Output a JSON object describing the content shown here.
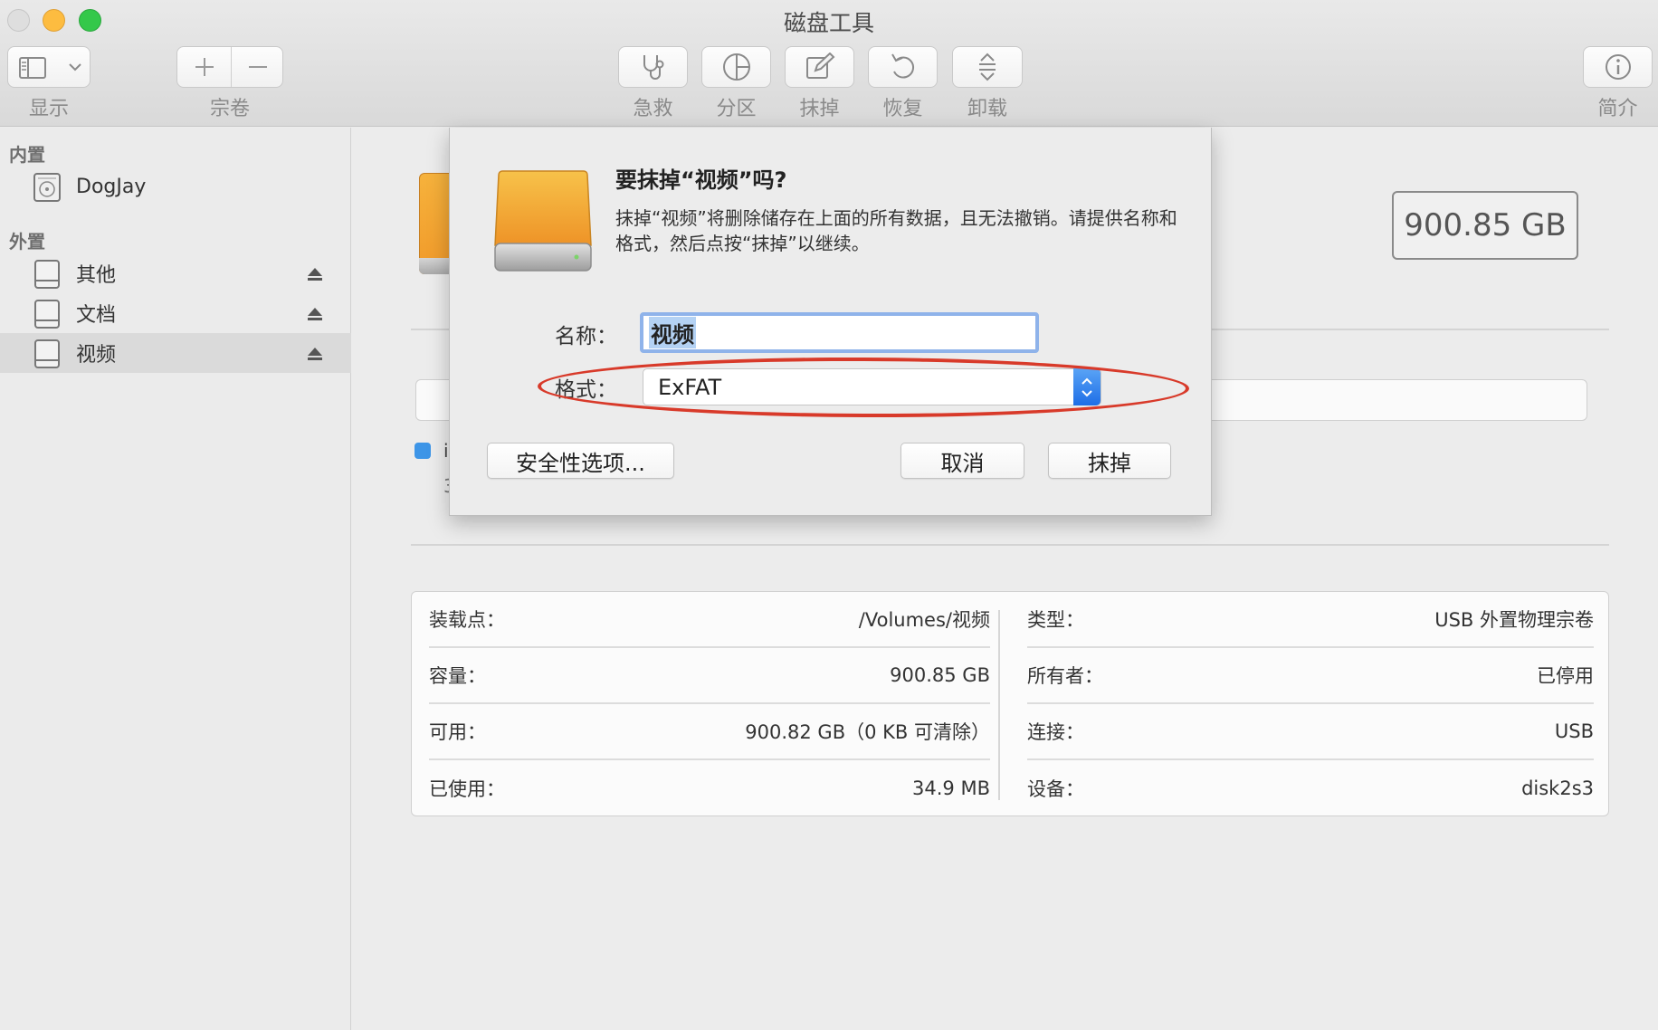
{
  "window": {
    "title": "磁盘工具"
  },
  "toolbar": {
    "display_label": "显示",
    "volume_label": "宗卷",
    "first_aid_label": "急救",
    "partition_label": "分区",
    "erase_label": "抹掉",
    "restore_label": "恢复",
    "unmount_label": "卸载",
    "info_label": "简介"
  },
  "sidebar": {
    "internal_header": "内置",
    "internal_items": [
      {
        "label": "DogJay"
      }
    ],
    "external_header": "外置",
    "external_items": [
      {
        "label": "其他"
      },
      {
        "label": "文档"
      },
      {
        "label": "视频",
        "selected": true
      }
    ]
  },
  "main": {
    "capacity_badge": "900.85 GB",
    "legend_fragment": "i",
    "legend_sub_fragment": "3",
    "info": {
      "left": [
        {
          "key": "装载点：",
          "value": "/Volumes/视频"
        },
        {
          "key": "容量：",
          "value": "900.85 GB"
        },
        {
          "key": "可用：",
          "value": "900.82 GB（0 KB 可清除）"
        },
        {
          "key": "已使用：",
          "value": "34.9 MB"
        }
      ],
      "right": [
        {
          "key": "类型：",
          "value": "USB 外置物理宗卷"
        },
        {
          "key": "所有者：",
          "value": "已停用"
        },
        {
          "key": "连接：",
          "value": "USB"
        },
        {
          "key": "设备：",
          "value": "disk2s3"
        }
      ]
    }
  },
  "dialog": {
    "title": "要抹掉“视频”吗?",
    "message": "抹掉“视频”将删除储存在上面的所有数据，且无法撤销。请提供名称和格式，然后点按“抹掉”以继续。",
    "name_label": "名称：",
    "name_value": "视频",
    "format_label": "格式：",
    "format_value": "ExFAT",
    "security_button": "安全性选项...",
    "cancel_button": "取消",
    "erase_button": "抹掉"
  },
  "colors": {
    "annotation_oval": "#d83a2a",
    "accent_blue": "#1e6ee6",
    "drive_orange": "#f19a2a"
  }
}
